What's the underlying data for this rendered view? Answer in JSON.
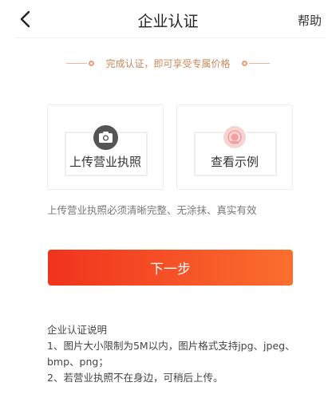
{
  "header": {
    "title": "企业认证",
    "help_label": "帮助"
  },
  "promo": {
    "text": "完成认证，即可享受专属价格"
  },
  "cards": {
    "upload_label": "上传营业执照",
    "sample_label": "查看示例"
  },
  "notice": "上传营业执照必须清晰完整、无涂抹、真实有效",
  "next_button": {
    "label": "下一步"
  },
  "instructions": {
    "title": "企业认证说明",
    "lines": [
      "1、图片大小限制为5M以内，图片格式支持jpg、jpeg、bmp、png；",
      "2、若营业执照不在身边，可稍后上传。"
    ]
  },
  "colors": {
    "accent_start": "#f0331e",
    "accent_end": "#fb6f2e",
    "promo_text": "#c98a5a"
  },
  "icons": {
    "back": "chevron-left-icon",
    "camera": "camera-icon",
    "sample": "badge-icon"
  }
}
